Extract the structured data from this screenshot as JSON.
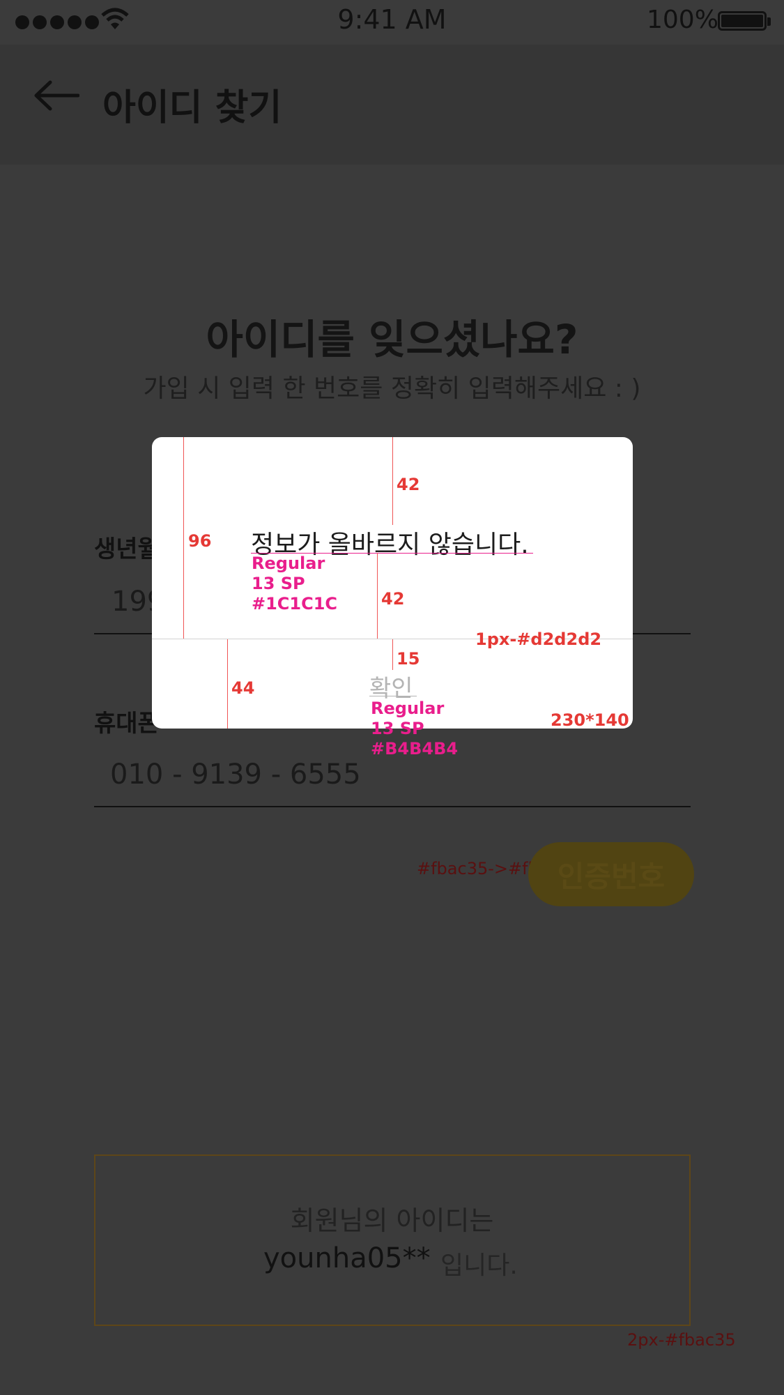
{
  "status_bar": {
    "time": "9:41 AM",
    "battery": "100%"
  },
  "header": {
    "title": "아이디 찾기"
  },
  "main": {
    "title": "아이디를 잊으셨나요?",
    "subtitle": "가입 시 입력 한 번호를 정확히 입력해주세요 : )"
  },
  "fields": {
    "birth_label": "생년월",
    "birth_value": "199",
    "phone_label": "휴대폰",
    "phone_value": "010 - 9139 - 6555"
  },
  "verify_button": {
    "label": "인증번호",
    "gradient_note": "#fbac35->#fbd135"
  },
  "result": {
    "line1": "회원님의 아이디는",
    "user_id": "younha05**",
    "suffix": "입니다.",
    "border_note": "2px-#fbac35"
  },
  "dialog": {
    "message": "정보가 올바르지 않습니다.",
    "confirm_label": "확인"
  },
  "spec_annotations": {
    "top_gap": "42",
    "left_height": "96",
    "msg_gap": "42",
    "msg_font": [
      "Regular",
      "13 SP",
      "#1C1C1C"
    ],
    "divider": "1px-#d2d2d2",
    "ok_gap": "15",
    "button_height": "44",
    "ok_font": [
      "Regular",
      "13 SP",
      "#B4B4B4"
    ],
    "size": "230*140"
  }
}
